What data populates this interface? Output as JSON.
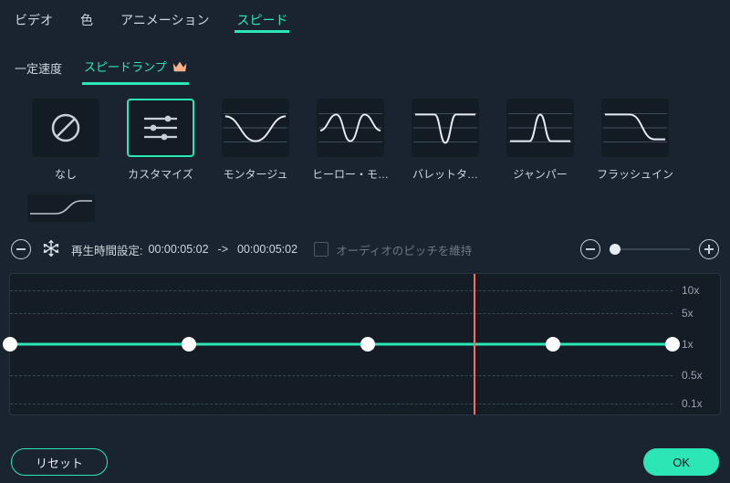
{
  "colors": {
    "accent": "#2de6b5",
    "bg": "#1a2430",
    "card": "#131b24",
    "playhead": "#ff6a5a"
  },
  "mainTabs": {
    "items": [
      {
        "label": "ビデオ",
        "active": false
      },
      {
        "label": "色",
        "active": false
      },
      {
        "label": "アニメーション",
        "active": false
      },
      {
        "label": "スピード",
        "active": true
      }
    ]
  },
  "subTabs": {
    "items": [
      {
        "label": "一定速度",
        "active": false,
        "premium": false
      },
      {
        "label": "スピードランプ",
        "active": true,
        "premium": true
      }
    ]
  },
  "presets": {
    "items": [
      {
        "name": "none",
        "label": "なし",
        "selected": false
      },
      {
        "name": "customize",
        "label": "カスタマイズ",
        "selected": true
      },
      {
        "name": "montage",
        "label": "モンタージュ",
        "selected": false
      },
      {
        "name": "hero",
        "label": "ヒーロー・モ…",
        "selected": false
      },
      {
        "name": "bullet",
        "label": "バレットタ…",
        "selected": false
      },
      {
        "name": "jumper",
        "label": "ジャンパー",
        "selected": false
      },
      {
        "name": "flash-in",
        "label": "フラッシュイン",
        "selected": false
      }
    ]
  },
  "duration": {
    "label": "再生時間設定",
    "from": "00:00:05:02",
    "arrow": "->",
    "to": "00:00:05:02"
  },
  "pitch": {
    "label": "オーディオのピッチを維持",
    "checked": false,
    "enabled": false
  },
  "zoom": {
    "min": 0,
    "max": 100,
    "value": 4
  },
  "chart_data": {
    "type": "line",
    "title": "",
    "xlabel": "",
    "ylabel": "",
    "y_ticks": [
      "10x",
      "5x",
      "1x",
      "0.5x",
      "0.1x"
    ],
    "y_tick_positions_pct": [
      12,
      28,
      50,
      72,
      92
    ],
    "x_range_pct": [
      0,
      100
    ],
    "series": [
      {
        "name": "speed-curve",
        "x_pct": [
          0,
          27,
          54,
          82,
          100
        ],
        "y_label": [
          "1x",
          "1x",
          "1x",
          "1x",
          "1x"
        ]
      }
    ],
    "keyframes_x_pct": [
      0,
      27,
      54,
      82,
      100
    ],
    "playhead_x_pct": 70
  },
  "buttons": {
    "reset": "リセット",
    "ok": "OK"
  },
  "snowflake_icon": "freeze-frame"
}
